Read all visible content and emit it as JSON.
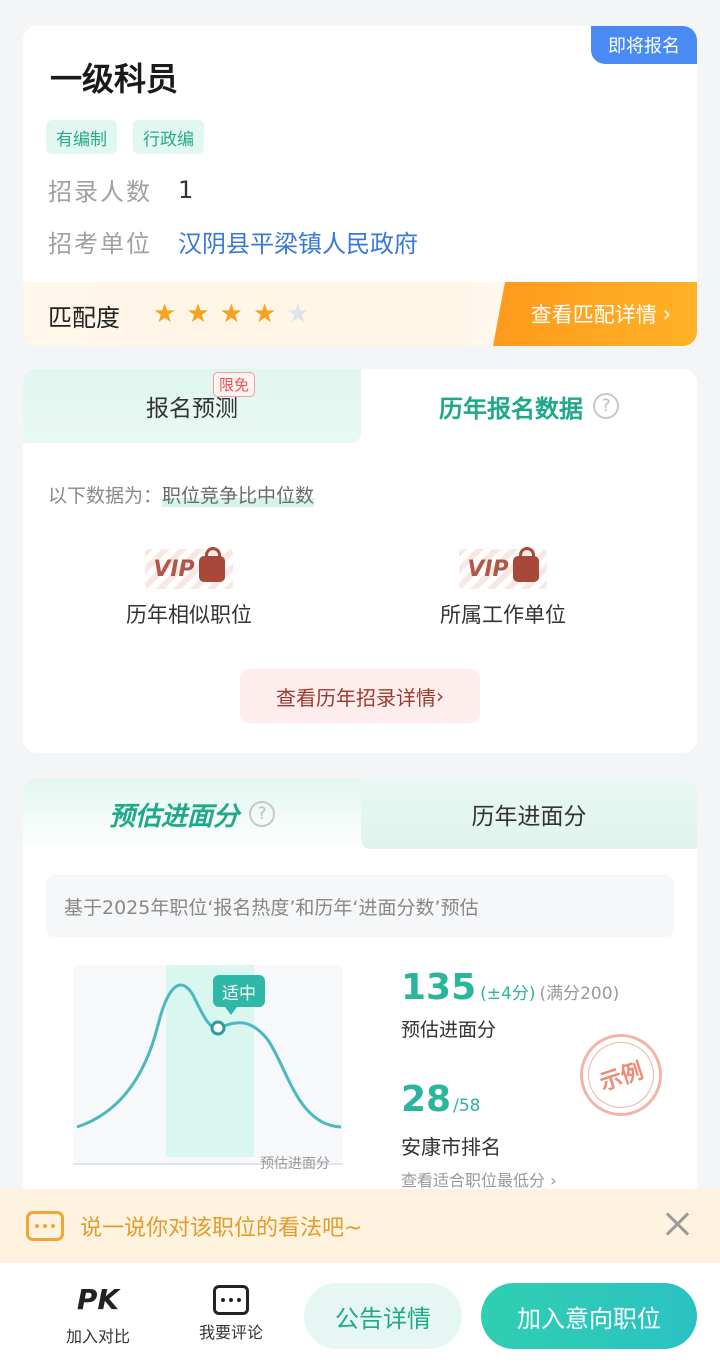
{
  "job": {
    "title": "一级科员",
    "status_badge": "即将报名",
    "tags": [
      "有编制",
      "行政编"
    ],
    "recruit_count_label": "招录人数",
    "recruit_count": "1",
    "unit_label": "招考单位",
    "unit": "汉阴县平梁镇人民政府"
  },
  "match": {
    "label": "匹配度",
    "stars": 4,
    "max_stars": 5,
    "detail_button": "查看匹配详情",
    "accent": "#ff9a1c"
  },
  "apply_data": {
    "tab_predict": "报名预测",
    "free_badge": "限免",
    "tab_history": "历年报名数据",
    "help": "?",
    "note_prefix": "以下数据为：",
    "note_highlight": "职位竞争比中位数",
    "vip_text": "VIP",
    "col_similar": "历年相似职位",
    "col_unit": "所属工作单位",
    "history_button": "查看历年招录详情"
  },
  "interview": {
    "tab_estimate": "预估进面分",
    "help": "?",
    "tab_history": "历年进面分",
    "note": "基于2025年职位‘报名热度’和历年‘进面分数’预估",
    "bubble": "适中",
    "axis_label": "预估进面分",
    "score": "135",
    "score_range": "(±4分)",
    "score_full": "(满分200)",
    "score_label": "预估进面分",
    "rank": "28",
    "rank_total": "/58",
    "rank_label": "安康市排名",
    "lowest_link": "查看适合职位最低分",
    "stamp": "示例",
    "accent": "#2bb59d"
  },
  "comment": {
    "prompt": "说一说你对该职位的看法吧~",
    "icon": "chat-bubble-icon"
  },
  "bottom": {
    "pk_icon": "PK",
    "pk_label": "加入对比",
    "comment_label": "我要评论",
    "notice_button": "公告详情",
    "add_button": "加入意向职位"
  }
}
